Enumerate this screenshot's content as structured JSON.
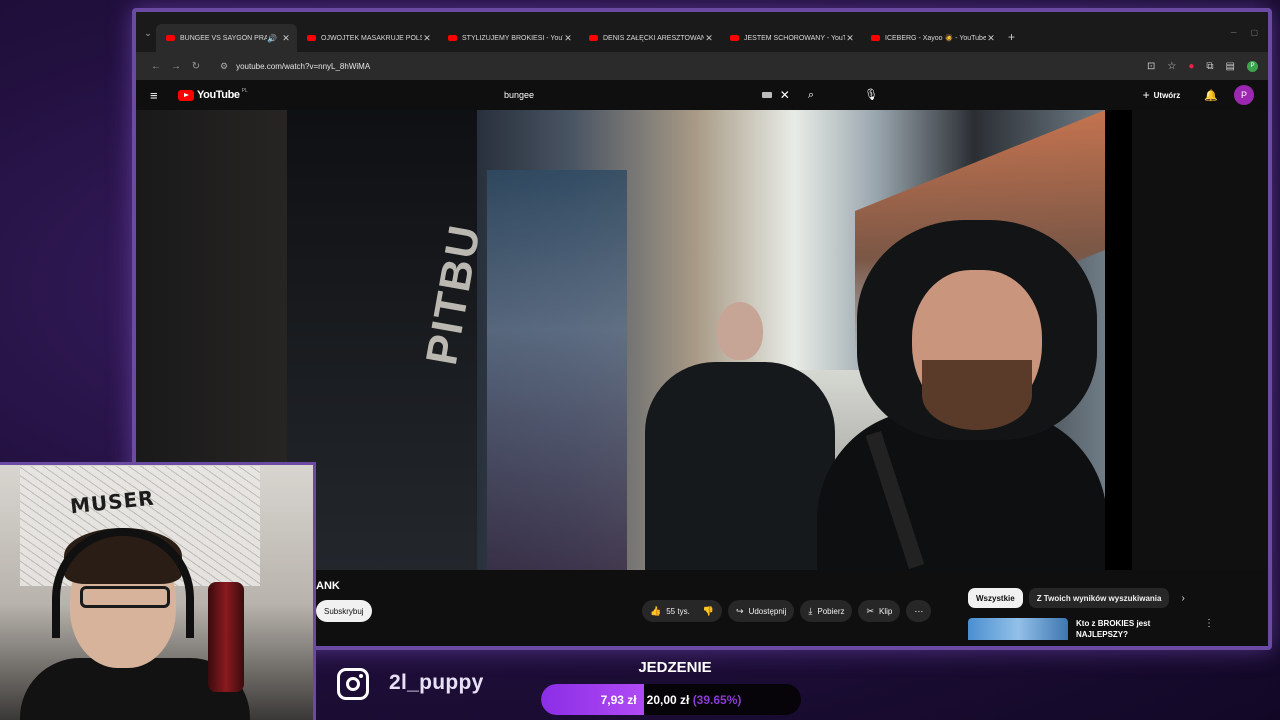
{
  "browser": {
    "tabs": [
      {
        "label": "BUNGEE VS SAYGON PRAN",
        "active": true,
        "sound": true
      },
      {
        "label": "OJWOJTEK MASAKRUJE POLSK",
        "active": false
      },
      {
        "label": "STYLIZUJEMY BROKIESI - YouTu",
        "active": false
      },
      {
        "label": "DENIS ZAŁĘCKI ARESZTOWANY",
        "active": false
      },
      {
        "label": "JESTEM SCHOROWANY - YouTu",
        "active": false
      },
      {
        "label": "ICEBERG - Xayoo 🧔 - YouTube",
        "active": false
      }
    ],
    "url": "youtube.com/watch?v=nnyL_8hWiMA"
  },
  "youtube": {
    "logo_text": "YouTube",
    "logo_region": "PL",
    "search_value": "bungee",
    "create_label": "Utwórz",
    "avatar_letter": "P",
    "video_title": "ANK",
    "video_sign": "PITBU",
    "subscribe_label": "Subskrybuj",
    "like_count": "55 tys.",
    "share_label": "Udostępnij",
    "download_label": "Pobierz",
    "clip_label": "Klip",
    "chips": [
      "Wszystkie",
      "Z Twoich wyników wyszukiwania"
    ],
    "suggestion_title": "Kto z BROKIES jest NAJLEPSZY?"
  },
  "webcam": {
    "mural_text": "MUSER"
  },
  "overlay": {
    "instagram_handle": "2l_puppy",
    "goal_title": "JEDZENIE",
    "goal_current": "7,93 zł",
    "goal_target": "20,00 zł",
    "goal_percent_text": "(39.65%)",
    "goal_fraction": 0.3965,
    "accent": "#a03ef0"
  }
}
